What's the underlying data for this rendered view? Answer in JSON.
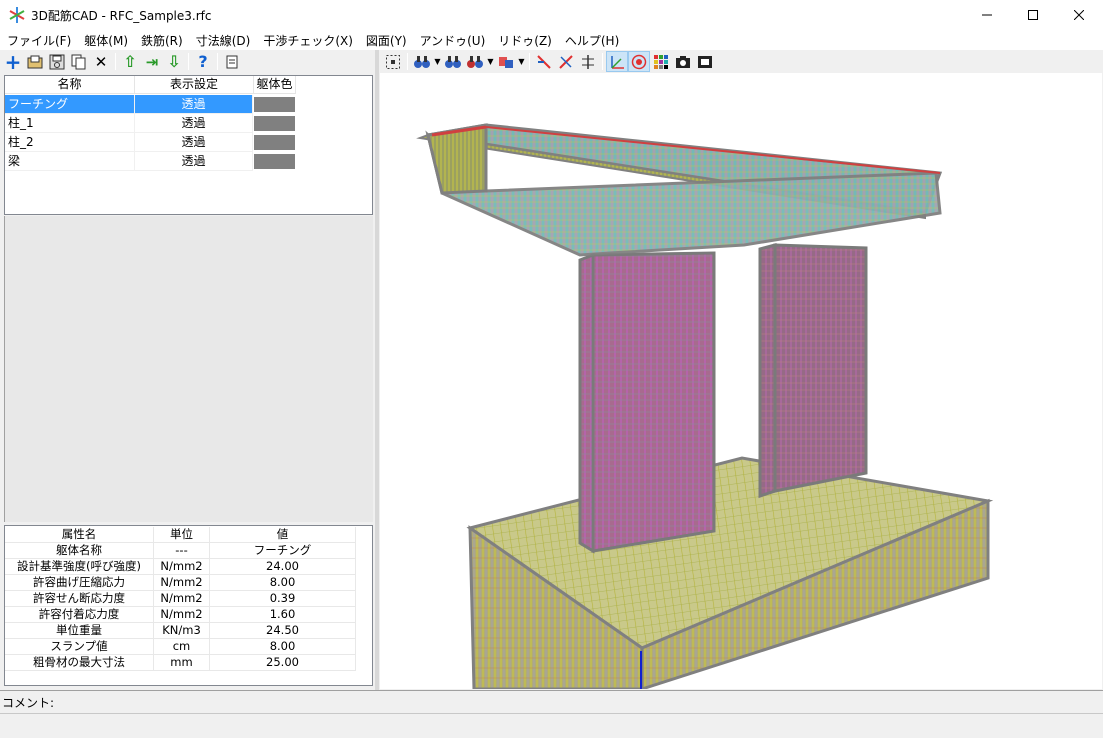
{
  "window": {
    "title": "3D配筋CAD - RFC_Sample3.rfc",
    "minimize_glyph": "─",
    "maximize_glyph": "☐",
    "close_glyph": "✕"
  },
  "menu": [
    "ファイル(F)",
    "躯体(M)",
    "鉄筋(R)",
    "寸法線(D)",
    "干渉チェック(X)",
    "図面(Y)",
    "アンドゥ(U)",
    "リドゥ(Z)",
    "ヘルプ(H)"
  ],
  "left_toolbar": {
    "icons": [
      "add-icon",
      "open-folder-icon",
      "save-icon",
      "copy-icon",
      "delete-icon",
      "move-up-icon",
      "indent-icon",
      "move-down-icon",
      "help-icon",
      "document-icon"
    ],
    "glyphs": {
      "add": "+",
      "delete": "✕",
      "help": "?",
      "up": "⇧",
      "down": "⇩",
      "indent": "⇥"
    }
  },
  "view_toolbar": {
    "icons": [
      "fit-view-icon",
      "view-binoculars-icon",
      "view-front-icon",
      "view-side-icon",
      "view-axis-icon",
      "dimension-icon",
      "rebar-display-icon",
      "align-icon",
      "axis-toggle-icon",
      "target-icon",
      "color-palette-icon",
      "camera-icon",
      "screenshot-icon"
    ],
    "dropdown_glyph": "▼"
  },
  "member_list": {
    "headers": [
      "名称",
      "表示設定",
      "躯体色"
    ],
    "rows": [
      {
        "name": "フーチング",
        "display": "透過",
        "color": "#808080",
        "selected": true
      },
      {
        "name": "柱_1",
        "display": "透過",
        "color": "#808080",
        "selected": false
      },
      {
        "name": "柱_2",
        "display": "透過",
        "color": "#808080",
        "selected": false
      },
      {
        "name": "梁",
        "display": "透過",
        "color": "#808080",
        "selected": false
      }
    ]
  },
  "properties": {
    "headers": [
      "属性名",
      "単位",
      "値"
    ],
    "rows": [
      {
        "name": "躯体名称",
        "unit": "---",
        "value": "フーチング"
      },
      {
        "name": "設計基準強度(呼び強度)",
        "unit": "N/mm2",
        "value": "24.00"
      },
      {
        "name": "許容曲げ圧縮応力",
        "unit": "N/mm2",
        "value": "8.00"
      },
      {
        "name": "許容せん断応力度",
        "unit": "N/mm2",
        "value": "0.39"
      },
      {
        "name": "許容付着応力度",
        "unit": "N/mm2",
        "value": "1.60"
      },
      {
        "name": "単位重量",
        "unit": "KN/m3",
        "value": "24.50"
      },
      {
        "name": "スランプ値",
        "unit": "cm",
        "value": "8.00"
      },
      {
        "name": "粗骨材の最大寸法",
        "unit": "mm",
        "value": "25.00"
      }
    ]
  },
  "comment_label": "コメント:",
  "colors": {
    "selection": "#3399ff",
    "rebar_footing": "#c8c832",
    "rebar_column": "#b050b0",
    "rebar_beam": "#50b4c8",
    "concrete": "#808080"
  }
}
